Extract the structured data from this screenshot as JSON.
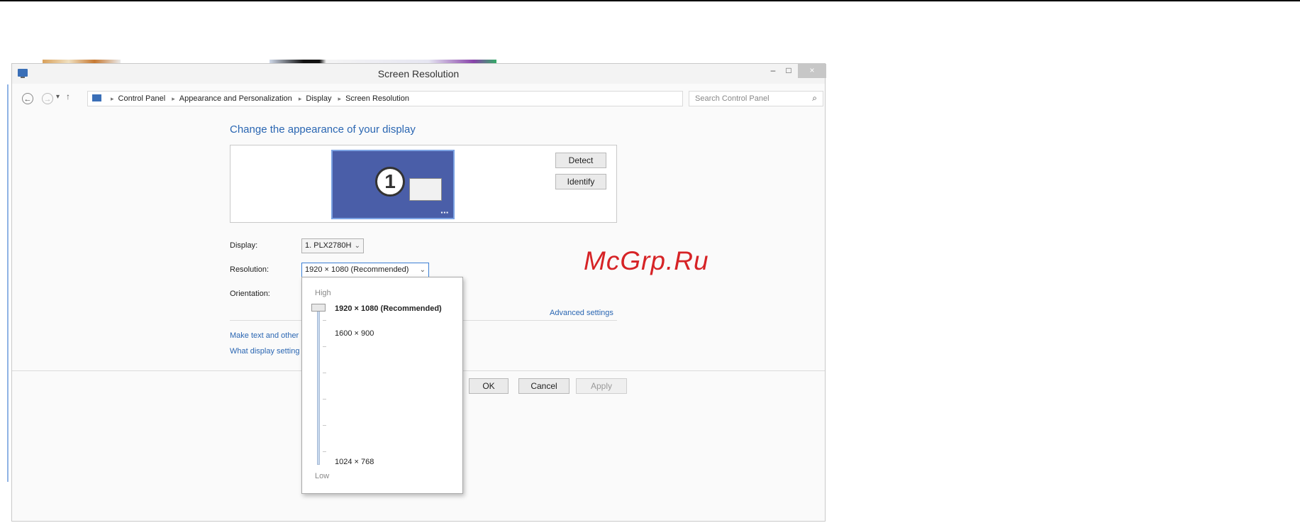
{
  "window": {
    "title": "Screen Resolution",
    "controls": {
      "minimize": "–",
      "maximize": "□",
      "close": "×"
    }
  },
  "addressbar": {
    "breadcrumbs": [
      "Control Panel",
      "Appearance and Personalization",
      "Display",
      "Screen Resolution"
    ],
    "search_placeholder": "Search Control Panel"
  },
  "main": {
    "heading": "Change the appearance of your display",
    "monitor_number": "1",
    "detect_label": "Detect",
    "identify_label": "Identify",
    "display_label": "Display:",
    "display_value": "1. PLX2780H",
    "resolution_label": "Resolution:",
    "resolution_value": "1920 × 1080 (Recommended)",
    "orientation_label": "Orientation:",
    "advanced_link": "Advanced settings",
    "link_text_size": "Make text and other",
    "link_display_settings": "What display setting",
    "ok_label": "OK",
    "cancel_label": "Cancel",
    "apply_label": "Apply"
  },
  "resolution_popup": {
    "high_label": "High",
    "low_label": "Low",
    "options": [
      "1920 × 1080 (Recommended)",
      "1600 × 900",
      "1024 × 768"
    ],
    "selected": "1920 × 1080 (Recommended)"
  },
  "watermark": "McGrp.Ru",
  "colors": {
    "link": "#2a66b2",
    "watermark": "#d62326",
    "monitor": "#4a5ea8"
  }
}
